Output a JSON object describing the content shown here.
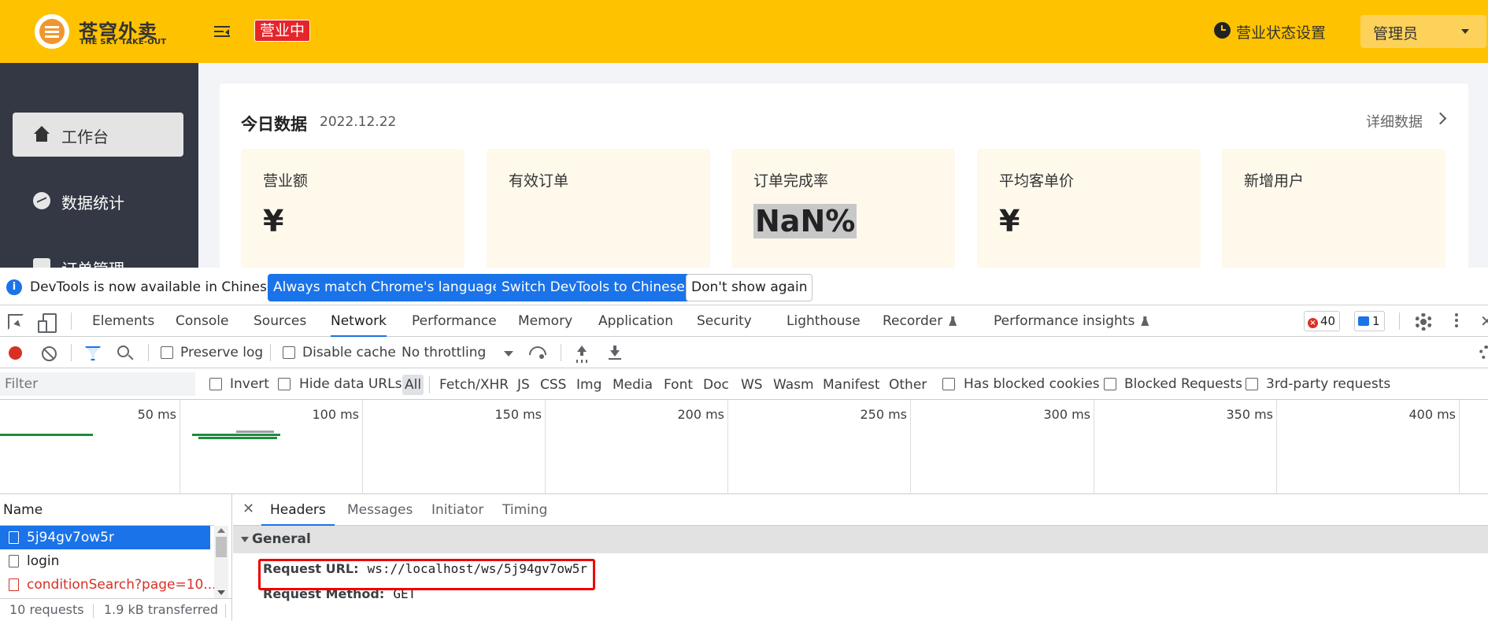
{
  "app": {
    "logo_title": "苍穹外卖",
    "logo_subtitle": "THE SKY TAKE-OUT",
    "business_status": "营业中",
    "status_settings": "营业状态设置",
    "admin_name": "管理员",
    "sidebar": [
      {
        "label": "工作台",
        "icon": "home-icon",
        "active": true
      },
      {
        "label": "数据统计",
        "icon": "chart-icon",
        "active": false
      },
      {
        "label": "订单管理",
        "icon": "clipboard-icon",
        "active": false
      }
    ],
    "today": {
      "title": "今日数据",
      "date": "2022.12.22",
      "detail_link": "详细数据",
      "stats": [
        {
          "label": "营业额",
          "value": "¥"
        },
        {
          "label": "有效订单",
          "value": ""
        },
        {
          "label": "订单完成率",
          "value": "NaN%"
        },
        {
          "label": "平均客单价",
          "value": "¥"
        },
        {
          "label": "新增用户",
          "value": ""
        }
      ]
    }
  },
  "devtools": {
    "infobar": {
      "text": "DevTools is now available in Chinese!",
      "btn_match": "Always match Chrome's language",
      "btn_switch": "Switch DevTools to Chinese",
      "btn_dismiss": "Don't show again"
    },
    "tabs": [
      "Elements",
      "Console",
      "Sources",
      "Network",
      "Performance",
      "Memory",
      "Application",
      "Security",
      "Lighthouse",
      "Recorder",
      "Performance insights"
    ],
    "active_tab": "Network",
    "error_count": "40",
    "message_count": "1",
    "toolbar": {
      "preserve_log": "Preserve log",
      "disable_cache": "Disable cache",
      "throttling": "No throttling"
    },
    "filter": {
      "placeholder": "Filter",
      "invert": "Invert",
      "hide_data_urls": "Hide data URLs",
      "types": [
        "All",
        "Fetch/XHR",
        "JS",
        "CSS",
        "Img",
        "Media",
        "Font",
        "Doc",
        "WS",
        "Wasm",
        "Manifest",
        "Other"
      ],
      "has_blocked_cookies": "Has blocked cookies",
      "blocked_requests": "Blocked Requests",
      "third_party": "3rd-party requests"
    },
    "timeline_ticks": [
      "50 ms",
      "100 ms",
      "150 ms",
      "200 ms",
      "250 ms",
      "300 ms",
      "350 ms",
      "400 ms"
    ],
    "requests": {
      "header": "Name",
      "rows": [
        "5j94gv7ow5r",
        "login",
        "conditionSearch?page=10..."
      ],
      "summary_count": "10 requests",
      "summary_size": "1.9 kB transferred"
    },
    "detail": {
      "tabs": [
        "Headers",
        "Messages",
        "Initiator",
        "Timing"
      ],
      "section": "General",
      "request_url_key": "Request URL:",
      "request_url_val": "ws://localhost/ws/5j94gv7ow5r",
      "request_method_key": "Request Method:",
      "request_method_val": "GET"
    }
  }
}
